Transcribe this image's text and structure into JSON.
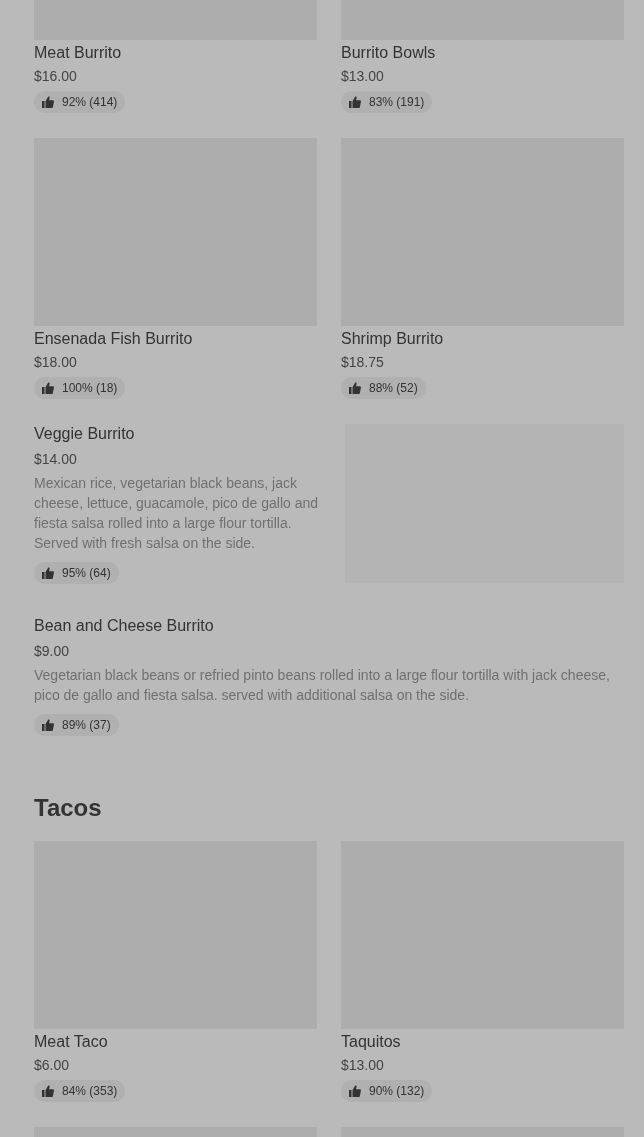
{
  "sections": [
    {
      "items": [
        {
          "kind": "tile",
          "name": "Meat Burrito",
          "price": "$16.00",
          "rating": "92% (414)"
        },
        {
          "kind": "tile",
          "name": "Burrito Bowls",
          "price": "$13.00",
          "rating": "83% (191)"
        },
        {
          "kind": "tile",
          "name": "Ensenada Fish Burrito",
          "price": "$18.00",
          "rating": "100% (18)"
        },
        {
          "kind": "tile",
          "name": "Shrimp Burrito",
          "price": "$18.75",
          "rating": "88% (52)"
        },
        {
          "kind": "wide",
          "image": true,
          "name": "Veggie Burrito",
          "price": "$14.00",
          "description": "Mexican rice, vegetarian black beans, jack cheese, lettuce, guacamole, pico de gallo and fiesta salsa rolled into a large flour tortilla. Served with fresh salsa on the side.",
          "rating": "95% (64)"
        },
        {
          "kind": "wide",
          "image": false,
          "name": "Bean and Cheese Burrito",
          "price": "$9.00",
          "description": "Vegetarian black beans or refried pinto beans rolled into a large flour tortilla with jack cheese, pico de gallo and fiesta salsa. served with additional salsa on the side.",
          "rating": "89% (37)"
        }
      ]
    },
    {
      "title": "Tacos",
      "items": [
        {
          "kind": "tile",
          "name": "Meat Taco",
          "price": "$6.00",
          "rating": "84% (353)"
        },
        {
          "kind": "tile",
          "name": "Taquitos",
          "price": "$13.00",
          "rating": "90% (132)"
        },
        {
          "kind": "tile"
        },
        {
          "kind": "tile"
        }
      ]
    }
  ]
}
